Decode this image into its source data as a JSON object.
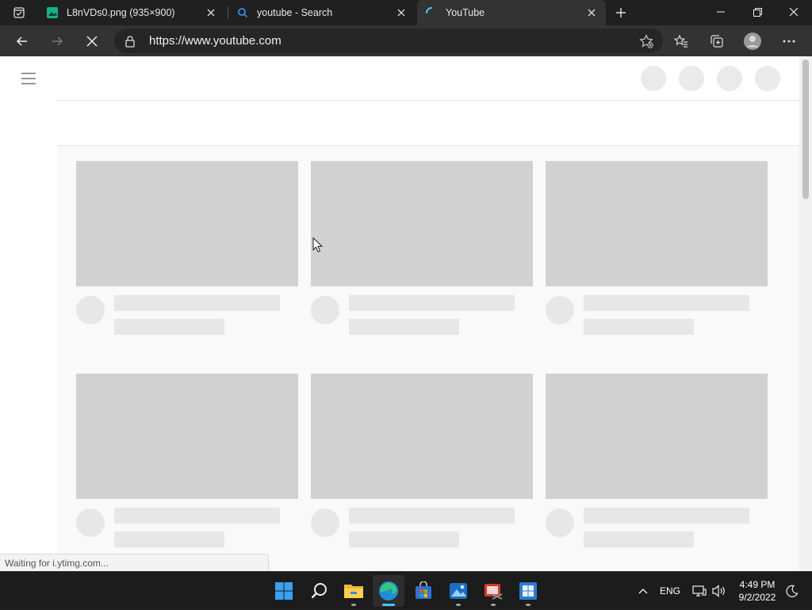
{
  "browser": {
    "tabs": [
      {
        "title": "L8nVDs0.png (935×900)",
        "favicon": "image-icon",
        "active": false
      },
      {
        "title": "youtube - Search",
        "favicon": "search-icon",
        "active": false
      },
      {
        "title": "YouTube",
        "favicon": "loading-spinner-icon",
        "active": true
      }
    ],
    "url": "https://www.youtube.com",
    "status_text": "Waiting for i.ytimg.com..."
  },
  "youtube": {
    "skeleton_cards": 6
  },
  "taskbar": {
    "apps": [
      "start-icon",
      "search-icon",
      "file-explorer-icon",
      "edge-icon",
      "store-icon",
      "photos-icon",
      "snipping-tool-icon",
      "windows-app-icon"
    ],
    "tray": {
      "language": "ENG",
      "time": "4:49 PM",
      "date": "9/2/2022"
    }
  },
  "colors": {
    "chrome_dark": "#202020",
    "toolbar": "#333333",
    "page_bg": "#f9f9f9",
    "skeleton_thumb": "#d1d1d1",
    "skeleton_text": "#e7e7e7",
    "edge_accent": "#4cc2ff"
  }
}
